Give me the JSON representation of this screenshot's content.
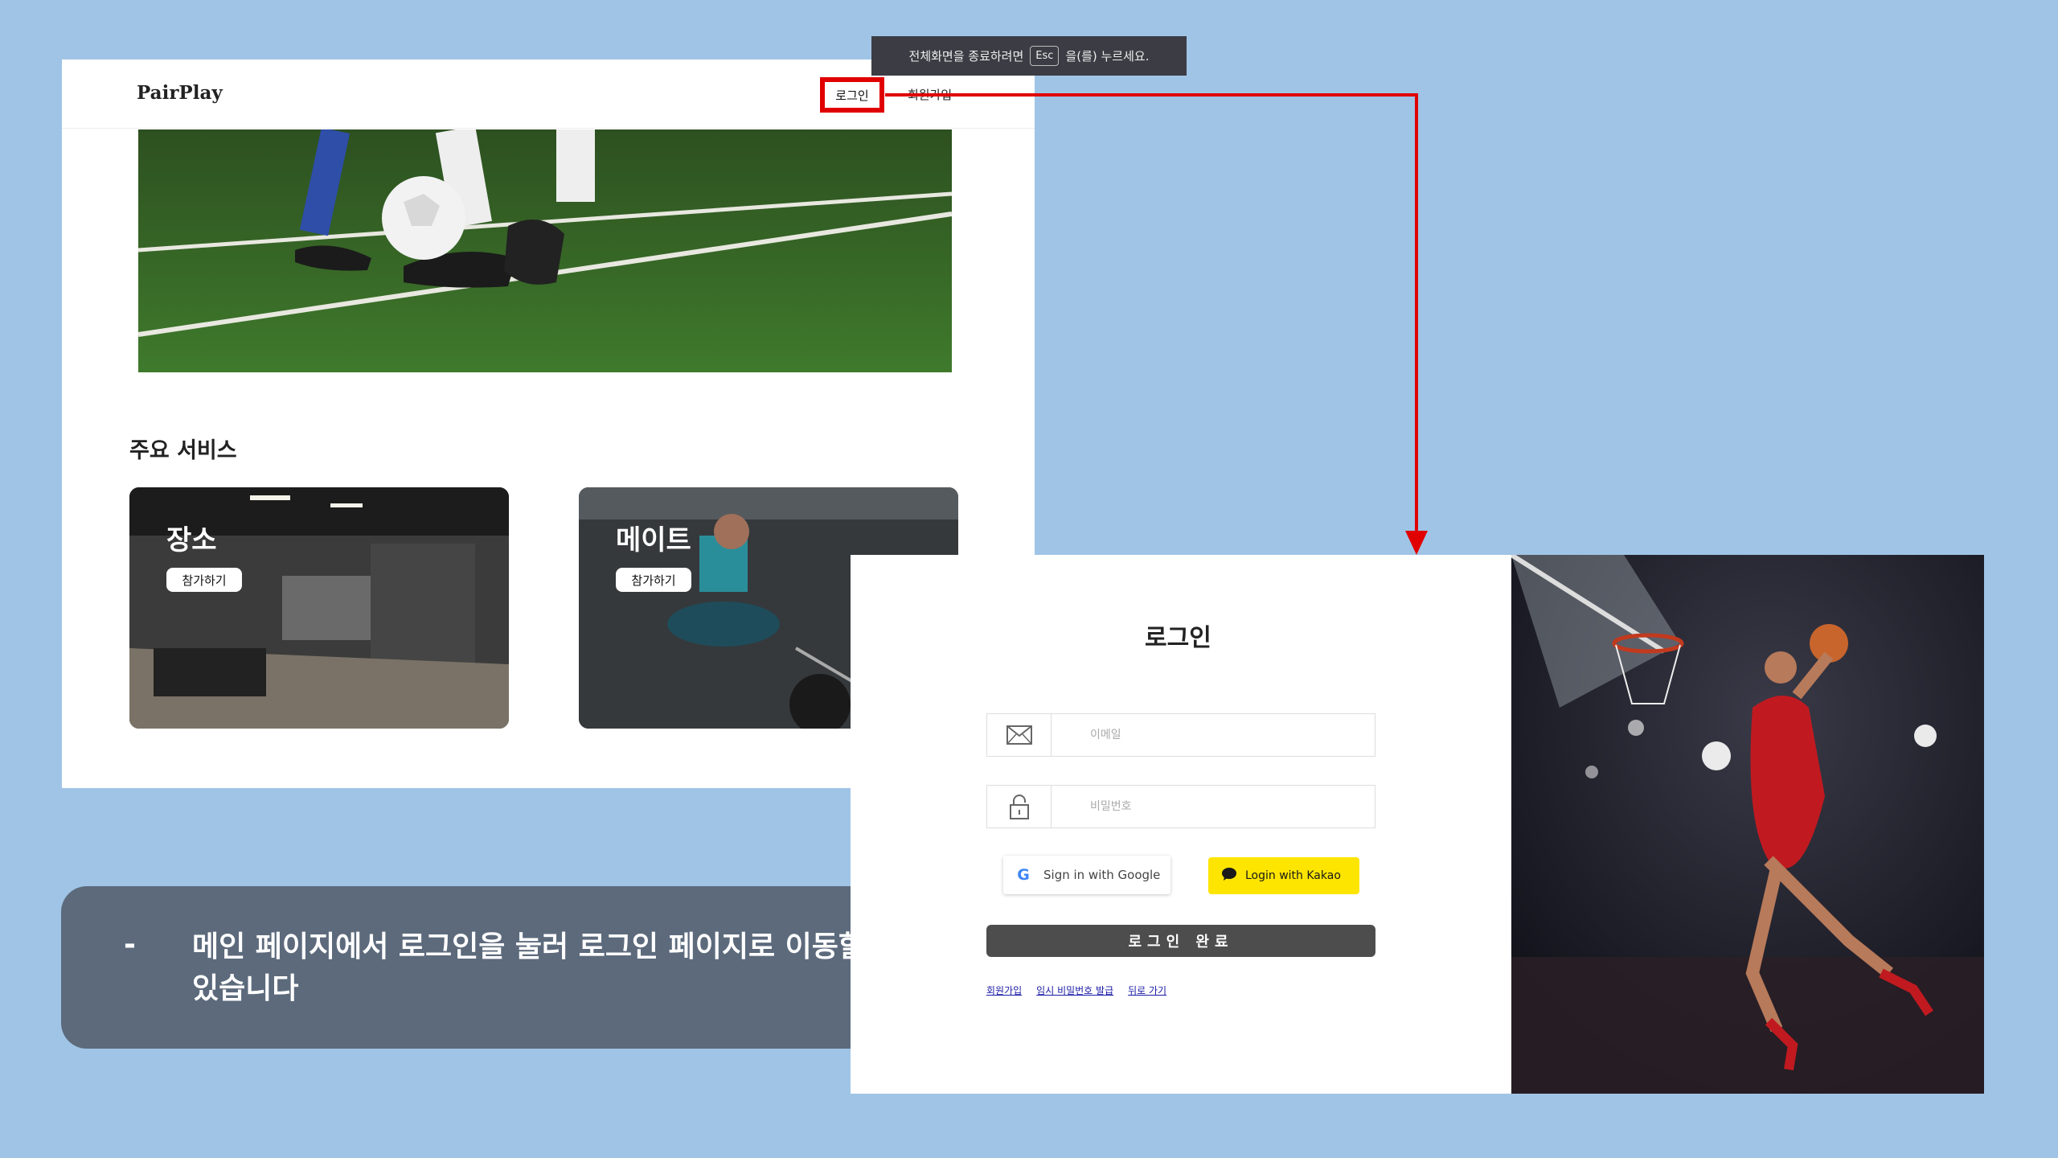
{
  "main_page": {
    "logo": "PairPlay",
    "nav": {
      "login": "로그인",
      "signup": "회원가입"
    },
    "section_title": "주요 서비스",
    "cards": [
      {
        "title": "장소",
        "button": "참가하기"
      },
      {
        "title": "메이트",
        "button": "참가하기"
      }
    ]
  },
  "fullscreen_toast": {
    "before": "전체화면을 종료하려면",
    "key": "Esc",
    "after": "을(를) 누르세요."
  },
  "caption": {
    "bullet": "-",
    "text": "메인 페이지에서 로그인을 눌러 로그인 페이지로 이동할 수 있습니다"
  },
  "login_page": {
    "title": "로그인",
    "email_placeholder": "이메일",
    "password_placeholder": "비밀번호",
    "google_button": "Sign in with Google",
    "kakao_button": "Login with Kakao",
    "submit_button": "로그인 완료",
    "links": [
      "회원가입",
      "임시 비밀번호 발급",
      "뒤로 가기"
    ]
  },
  "colors": {
    "background": "#a0c4e6",
    "highlight": "#e00000",
    "kakao": "#fee500",
    "submit": "#4d4d4d",
    "caption_box": "#546070"
  },
  "icons": [
    "mail-icon",
    "lock-icon",
    "google-g-icon",
    "kakao-bubble-icon"
  ]
}
